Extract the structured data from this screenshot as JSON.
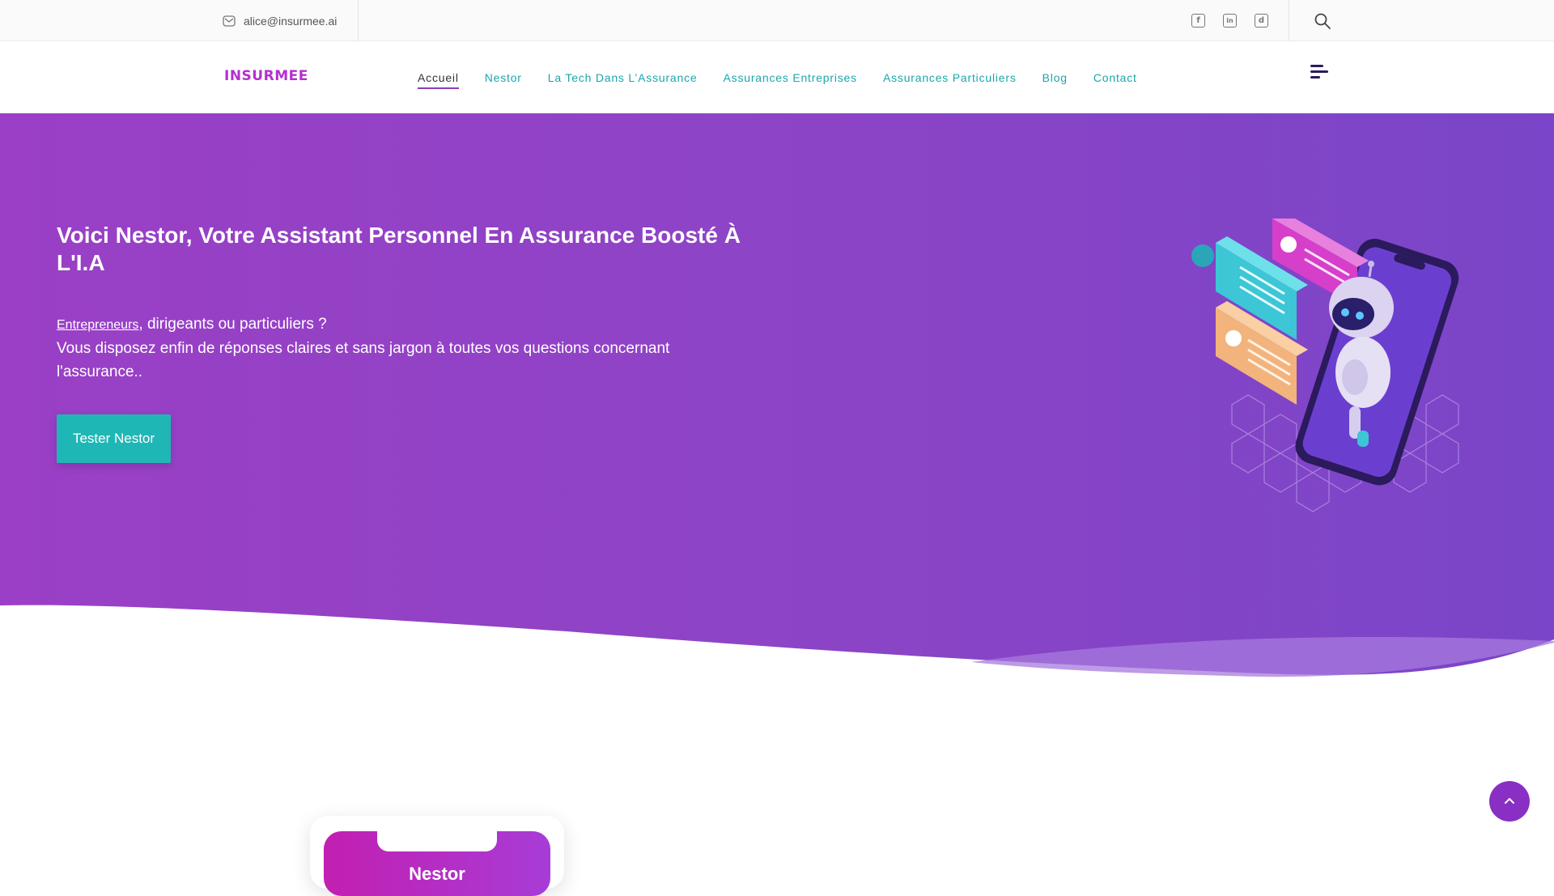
{
  "topbar": {
    "email": "alice@insurmee.ai",
    "socials": [
      {
        "name": "facebook-icon",
        "glyph": "f"
      },
      {
        "name": "linkedin-icon",
        "glyph": "in"
      },
      {
        "name": "website-icon",
        "glyph": "d"
      }
    ]
  },
  "header": {
    "logo": "INSURMEE",
    "nav": [
      {
        "label": "Accueil",
        "active": true
      },
      {
        "label": "Nestor"
      },
      {
        "label": "La Tech Dans L’Assurance"
      },
      {
        "label": "Assurances Entreprises"
      },
      {
        "label": "Assurances Particuliers"
      },
      {
        "label": "Blog"
      },
      {
        "label": "Contact"
      }
    ]
  },
  "hero": {
    "title": "Voici Nestor, Votre Assistant Personnel En Assurance Boosté À L'I.A",
    "lead_link": "Entrepreneurs",
    "lead_rest": ", dirigeants ou particuliers ?",
    "lead_line2": "Vous disposez enfin de réponses claires et sans jargon à toutes vos questions concernant l'assurance..",
    "cta": "Tester Nestor"
  },
  "card": {
    "title": "Nestor"
  },
  "colors": {
    "accent_purple": "#8e3dbd",
    "teal": "#1fb7b6",
    "nav_teal": "#1ba6aa",
    "logo": "#b52ed0"
  }
}
